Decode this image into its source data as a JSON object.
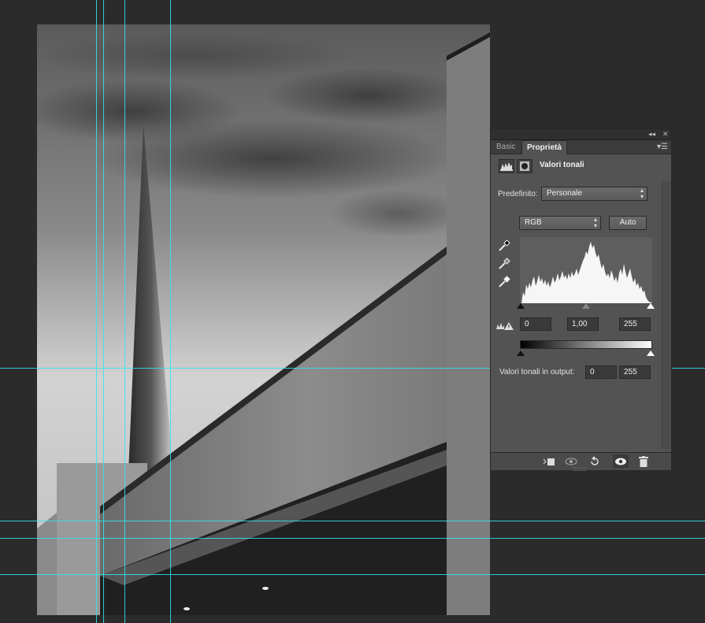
{
  "panel": {
    "tabs": [
      {
        "label": "Basic",
        "active": false
      },
      {
        "label": "Proprietà",
        "active": true
      }
    ],
    "header_controls": {
      "collapse": "◂◂",
      "close": "✕",
      "menu": "▾☰"
    },
    "adjustment": {
      "title": "Valori tonali",
      "icons": [
        "levels-icon",
        "mask-icon"
      ]
    },
    "preset": {
      "label": "Predefinito:",
      "value": "Personale"
    },
    "channel": {
      "value": "RGB"
    },
    "auto_button": "Auto",
    "eyedroppers": [
      "black-point-eyedropper-icon",
      "gray-point-eyedropper-icon",
      "white-point-eyedropper-icon"
    ],
    "input_levels": {
      "black": "0",
      "gamma": "1,00",
      "white": "255"
    },
    "output": {
      "label": "Valori tonali in output:",
      "black": "0",
      "white": "255"
    },
    "footer_icons": [
      "clip-to-layer-icon",
      "view-previous-state-icon",
      "reset-icon",
      "visibility-eye-icon",
      "trash-icon"
    ]
  },
  "colors": {
    "app_background": "#2b2b2b",
    "panel_background": "#535353",
    "guide": "#2ee8f0"
  }
}
